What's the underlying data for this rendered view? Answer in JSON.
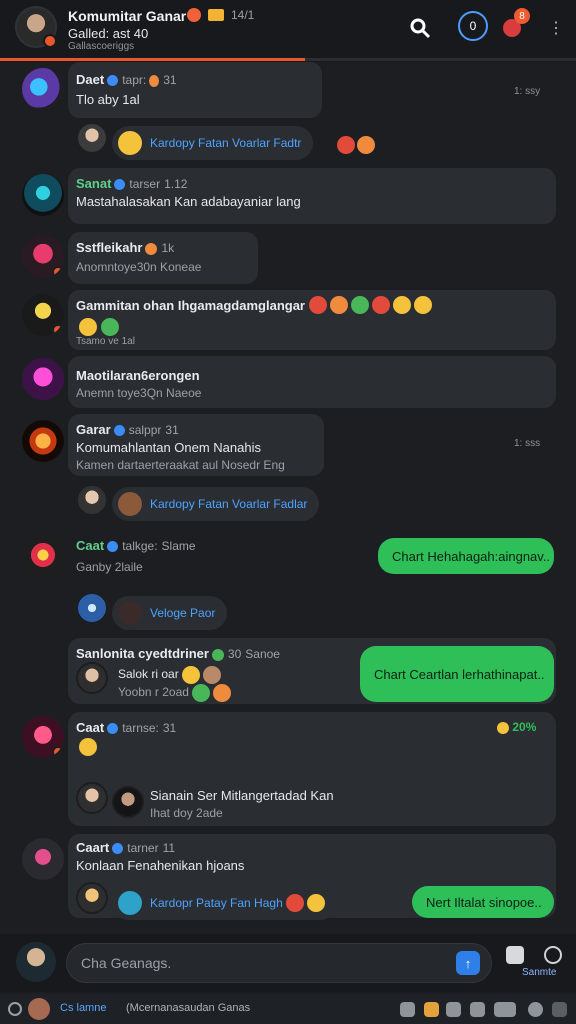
{
  "header": {
    "title": "Komumitar Ganar",
    "title_count": "14/1",
    "subtitle": "Galled: ast 40",
    "subtitle2": "Gallascoeriggs",
    "progress": 0.53,
    "timer_icon_text": "0",
    "alert_count": "8",
    "icons": [
      "search-icon",
      "timer-icon",
      "alert-icon",
      "more-icon"
    ]
  },
  "messages": [
    {
      "name": "Daet",
      "meta": "tapr:",
      "stat": "31",
      "text": "Tlo aby 1al",
      "time": "1: ssy"
    },
    {
      "name": "Sanat",
      "meta": "tarser",
      "stat": "1.12",
      "text": "Mastahalasakan Kan adabayaniar lang"
    },
    {
      "name": "Sstfleikahr",
      "meta": "1k",
      "sub": "Anomntoye30n Koneae"
    },
    {
      "name": "Gammitan ohan Ihgamagdamglangar",
      "sub": "Tsamo ve 1al"
    },
    {
      "name": "Maotilaran6erongen",
      "sub": "Anemn toye3Qn Naeoe"
    },
    {
      "name": "Garar",
      "meta": "salppr",
      "stat": "31",
      "text": "Komumahlantan Onem Nanahis",
      "sub": "Kamen dartaerteraakat aul Nosedr Eng",
      "time": "1: sss"
    },
    {
      "name": "Caat",
      "meta": "talkge:",
      "stat": "Slame",
      "sub": "Ganby 2laile",
      "green": "Chart Hehahagah:aingnav.."
    },
    {
      "name": "Sanlonita cyedtdriner",
      "stat": "30",
      "meta": "Sanoe",
      "text": "Salok ri oar",
      "sub": "Yoobn r 2oad",
      "green": "Chart Ceartlan lerhathinapat.."
    },
    {
      "name": "Caat",
      "meta": "tarnse:",
      "stat": "31",
      "green_small": "20%"
    },
    {
      "name": "Caart",
      "meta": "tarner",
      "stat": "11",
      "text": "Konlaan Fenahenikan hjoans",
      "green": "Nert Iltalat sinopoe.."
    }
  ],
  "replies": [
    {
      "text": "Kardopy Fatan Voarlar Fadtr"
    },
    {
      "text": "Kardopy Fatan Voarlar Fadlar"
    },
    {
      "text": "Veloge Paor"
    },
    {
      "text": "Sianain Ser Mitlangertadad Kan",
      "sub": "Ihat doy 2ade"
    },
    {
      "text": "Kardopr Patay Fan Hagh"
    }
  ],
  "composer": {
    "placeholder": "Cha Geanags.",
    "send": "↑",
    "action_label": "Sanmte"
  },
  "bottom": {
    "tab": "Cs lamne",
    "status": "(Mcernanasaudan Ganas"
  },
  "colors": {
    "accent": "#e9572b",
    "link": "#4fa3ff",
    "green": "#2fbf58"
  }
}
